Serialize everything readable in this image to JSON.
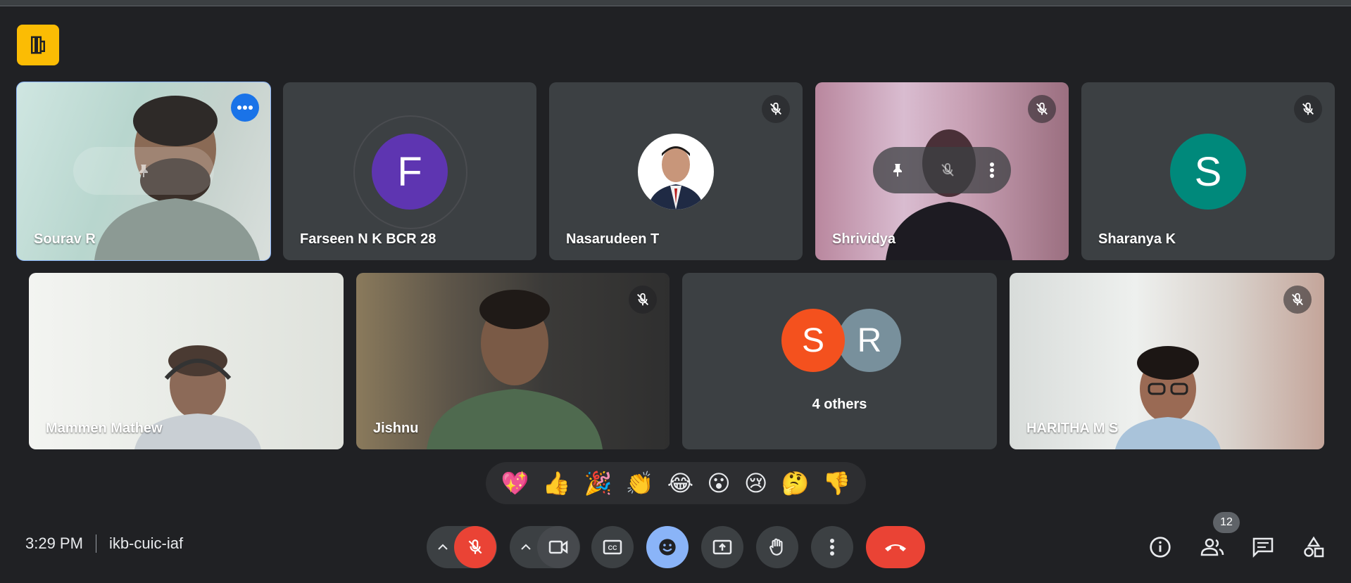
{
  "participants": [
    {
      "name": "Sourav R",
      "type": "video",
      "active": true
    },
    {
      "name": "Farseen N K BCR 28",
      "type": "avatar",
      "initial": "F",
      "color": "#5e35b1"
    },
    {
      "name": "Nasarudeen T",
      "type": "photo"
    },
    {
      "name": "Shrividya",
      "type": "video",
      "muted": true
    },
    {
      "name": "Sharanya K",
      "type": "avatar",
      "initial": "S",
      "color": "#00897b",
      "muted": true
    },
    {
      "name": "Mammen Mathew",
      "type": "video"
    },
    {
      "name": "Jishnu",
      "type": "video",
      "muted": true
    },
    {
      "name": "HARITHA M S",
      "type": "video",
      "muted": true
    }
  ],
  "others": {
    "label": "4 others",
    "avatars": [
      {
        "initial": "S",
        "color": "#f4511e"
      },
      {
        "initial": "R",
        "color": "#78909c"
      }
    ]
  },
  "reactions": [
    "💖",
    "👍",
    "🎉",
    "👏",
    "😂",
    "😮",
    "😢",
    "🤔",
    "👎"
  ],
  "meeting": {
    "time": "3:29 PM",
    "code": "ikb-cuic-iaf"
  },
  "people_count": "12",
  "colors": {
    "background": "#202124",
    "tile": "#3c4043",
    "end_call": "#ea4335",
    "accent": "#8ab4f8",
    "mic_off": "#ea4335"
  },
  "icons": {
    "top_left": "room-door-icon",
    "controls": [
      "chevron-up-icon",
      "mic-off-icon",
      "chevron-up-icon",
      "camera-icon",
      "captions-icon",
      "emoji-icon",
      "present-icon",
      "raise-hand-icon",
      "more-vert-icon",
      "end-call-icon"
    ],
    "right": [
      "info-icon",
      "people-icon",
      "chat-icon",
      "activities-icon"
    ]
  }
}
